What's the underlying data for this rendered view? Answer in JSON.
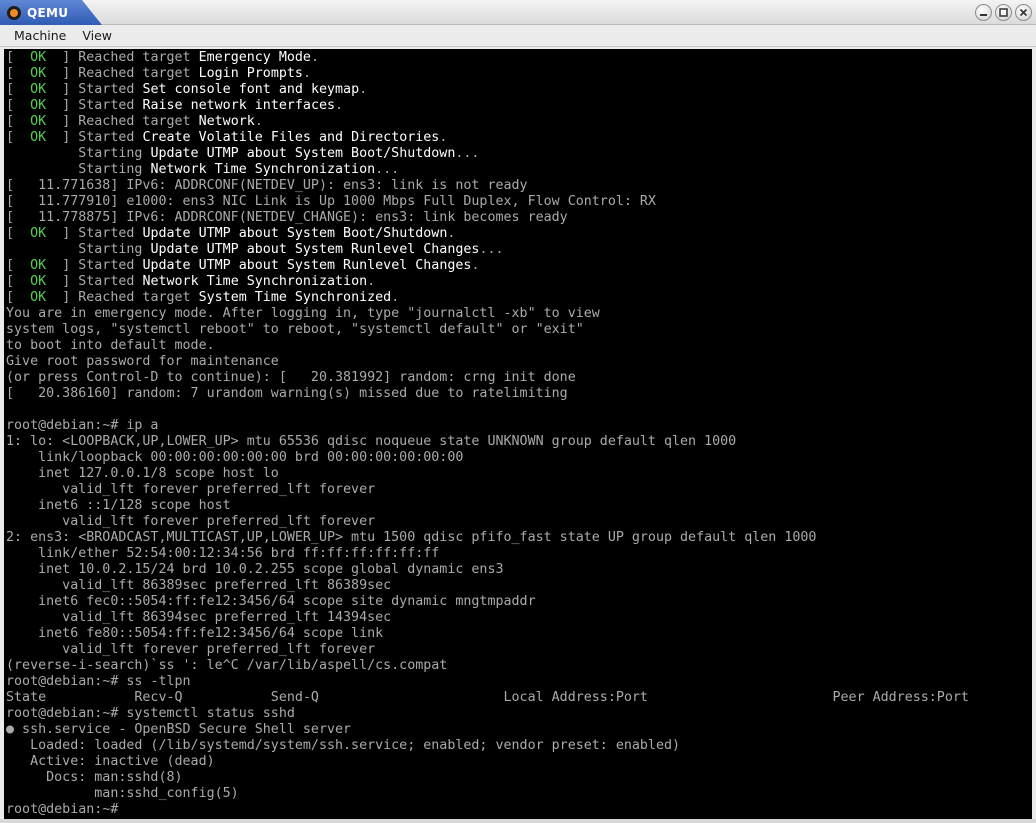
{
  "window": {
    "title": "QEMU",
    "buttons": {
      "minimize_icon": "minimize-icon",
      "maximize_icon": "maximize-icon",
      "close_icon": "close-icon"
    }
  },
  "menu": [
    "Machine",
    "View"
  ],
  "colors": {
    "terminal_bg": "#000000",
    "terminal_fg": "#aaaaaa",
    "terminal_bright": "#ffffff",
    "ok_green": "#55cc55",
    "title_accent": "#2f5bb4"
  },
  "terminal": {
    "lines": [
      {
        "segments": [
          {
            "text": "[  "
          },
          {
            "text": "OK",
            "c": "ok"
          },
          {
            "text": "  ] Reached target "
          },
          {
            "text": "Emergency Mode",
            "c": "hi"
          },
          {
            "text": "."
          }
        ]
      },
      {
        "segments": [
          {
            "text": "[  "
          },
          {
            "text": "OK",
            "c": "ok"
          },
          {
            "text": "  ] Reached target "
          },
          {
            "text": "Login Prompts",
            "c": "hi"
          },
          {
            "text": "."
          }
        ]
      },
      {
        "segments": [
          {
            "text": "[  "
          },
          {
            "text": "OK",
            "c": "ok"
          },
          {
            "text": "  ] Started "
          },
          {
            "text": "Set console font and keymap",
            "c": "hi"
          },
          {
            "text": "."
          }
        ]
      },
      {
        "segments": [
          {
            "text": "[  "
          },
          {
            "text": "OK",
            "c": "ok"
          },
          {
            "text": "  ] Started "
          },
          {
            "text": "Raise network interfaces",
            "c": "hi"
          },
          {
            "text": "."
          }
        ]
      },
      {
        "segments": [
          {
            "text": "[  "
          },
          {
            "text": "OK",
            "c": "ok"
          },
          {
            "text": "  ] Reached target "
          },
          {
            "text": "Network",
            "c": "hi"
          },
          {
            "text": "."
          }
        ]
      },
      {
        "segments": [
          {
            "text": "[  "
          },
          {
            "text": "OK",
            "c": "ok"
          },
          {
            "text": "  ] Started "
          },
          {
            "text": "Create Volatile Files and Directories",
            "c": "hi"
          },
          {
            "text": "."
          }
        ]
      },
      {
        "segments": [
          {
            "text": "         Starting "
          },
          {
            "text": "Update UTMP about System Boot/Shutdown",
            "c": "hi"
          },
          {
            "text": "..."
          }
        ]
      },
      {
        "segments": [
          {
            "text": "         Starting "
          },
          {
            "text": "Network Time Synchronization",
            "c": "hi"
          },
          {
            "text": "..."
          }
        ]
      },
      {
        "segments": [
          {
            "text": "[   11.771638] IPv6: ADDRCONF(NETDEV_UP): ens3: link is not ready"
          }
        ]
      },
      {
        "segments": [
          {
            "text": "[   11.777910] e1000: ens3 NIC Link is Up 1000 Mbps Full Duplex, Flow Control: RX"
          }
        ]
      },
      {
        "segments": [
          {
            "text": "[   11.778875] IPv6: ADDRCONF(NETDEV_CHANGE): ens3: link becomes ready"
          }
        ]
      },
      {
        "segments": [
          {
            "text": "[  "
          },
          {
            "text": "OK",
            "c": "ok"
          },
          {
            "text": "  ] Started "
          },
          {
            "text": "Update UTMP about System Boot/Shutdown",
            "c": "hi"
          },
          {
            "text": "."
          }
        ]
      },
      {
        "segments": [
          {
            "text": "         Starting "
          },
          {
            "text": "Update UTMP about System Runlevel Changes",
            "c": "hi"
          },
          {
            "text": "..."
          }
        ]
      },
      {
        "segments": [
          {
            "text": "[  "
          },
          {
            "text": "OK",
            "c": "ok"
          },
          {
            "text": "  ] Started "
          },
          {
            "text": "Update UTMP about System Runlevel Changes",
            "c": "hi"
          },
          {
            "text": "."
          }
        ]
      },
      {
        "segments": [
          {
            "text": "[  "
          },
          {
            "text": "OK",
            "c": "ok"
          },
          {
            "text": "  ] Started "
          },
          {
            "text": "Network Time Synchronization",
            "c": "hi"
          },
          {
            "text": "."
          }
        ]
      },
      {
        "segments": [
          {
            "text": "[  "
          },
          {
            "text": "OK",
            "c": "ok"
          },
          {
            "text": "  ] Reached target "
          },
          {
            "text": "System Time Synchronized",
            "c": "hi"
          },
          {
            "text": "."
          }
        ]
      },
      {
        "segments": [
          {
            "text": "You are in emergency mode. After logging in, type \"journalctl -xb\" to view"
          }
        ]
      },
      {
        "segments": [
          {
            "text": "system logs, \"systemctl reboot\" to reboot, \"systemctl default\" or \"exit\""
          }
        ]
      },
      {
        "segments": [
          {
            "text": "to boot into default mode."
          }
        ]
      },
      {
        "segments": [
          {
            "text": "Give root password for maintenance"
          }
        ]
      },
      {
        "segments": [
          {
            "text": "(or press Control-D to continue): [   20.381992] random: crng init done"
          }
        ]
      },
      {
        "segments": [
          {
            "text": "[   20.386160] random: 7 urandom warning(s) missed due to ratelimiting"
          }
        ]
      },
      {
        "segments": [
          {
            "text": ""
          }
        ]
      },
      {
        "segments": [
          {
            "text": "root@debian:~# ip a"
          }
        ]
      },
      {
        "segments": [
          {
            "text": "1: lo: <LOOPBACK,UP,LOWER_UP> mtu 65536 qdisc noqueue state UNKNOWN group default qlen 1000"
          }
        ]
      },
      {
        "segments": [
          {
            "text": "    link/loopback 00:00:00:00:00:00 brd 00:00:00:00:00:00"
          }
        ]
      },
      {
        "segments": [
          {
            "text": "    inet 127.0.0.1/8 scope host lo"
          }
        ]
      },
      {
        "segments": [
          {
            "text": "       valid_lft forever preferred_lft forever"
          }
        ]
      },
      {
        "segments": [
          {
            "text": "    inet6 ::1/128 scope host"
          }
        ]
      },
      {
        "segments": [
          {
            "text": "       valid_lft forever preferred_lft forever"
          }
        ]
      },
      {
        "segments": [
          {
            "text": "2: ens3: <BROADCAST,MULTICAST,UP,LOWER_UP> mtu 1500 qdisc pfifo_fast state UP group default qlen 1000"
          }
        ]
      },
      {
        "segments": [
          {
            "text": "    link/ether 52:54:00:12:34:56 brd ff:ff:ff:ff:ff:ff"
          }
        ]
      },
      {
        "segments": [
          {
            "text": "    inet 10.0.2.15/24 brd 10.0.2.255 scope global dynamic ens3"
          }
        ]
      },
      {
        "segments": [
          {
            "text": "       valid_lft 86389sec preferred_lft 86389sec"
          }
        ]
      },
      {
        "segments": [
          {
            "text": "    inet6 fec0::5054:ff:fe12:3456/64 scope site dynamic mngtmpaddr"
          }
        ]
      },
      {
        "segments": [
          {
            "text": "       valid_lft 86394sec preferred_lft 14394sec"
          }
        ]
      },
      {
        "segments": [
          {
            "text": "    inet6 fe80::5054:ff:fe12:3456/64 scope link"
          }
        ]
      },
      {
        "segments": [
          {
            "text": "       valid_lft forever preferred_lft forever"
          }
        ]
      },
      {
        "segments": [
          {
            "text": "(reverse-i-search)`ss ': le^C /var/lib/aspell/cs.compat"
          }
        ]
      },
      {
        "segments": [
          {
            "text": "root@debian:~# ss -tlpn"
          }
        ]
      },
      {
        "segments": [
          {
            "text": "State           Recv-Q           Send-Q                       Local Address:Port                       Peer Address:Port"
          }
        ]
      },
      {
        "segments": [
          {
            "text": "root@debian:~# systemctl status sshd"
          }
        ]
      },
      {
        "segments": [
          {
            "text": "● ssh.service - OpenBSD Secure Shell server"
          }
        ]
      },
      {
        "segments": [
          {
            "text": "   Loaded: loaded (/lib/systemd/system/ssh.service; enabled; vendor preset: enabled)"
          }
        ]
      },
      {
        "segments": [
          {
            "text": "   Active: inactive (dead)"
          }
        ]
      },
      {
        "segments": [
          {
            "text": "     Docs: man:sshd(8)"
          }
        ]
      },
      {
        "segments": [
          {
            "text": "           man:sshd_config(5)"
          }
        ]
      },
      {
        "segments": [
          {
            "text": "root@debian:~#"
          }
        ]
      }
    ]
  }
}
